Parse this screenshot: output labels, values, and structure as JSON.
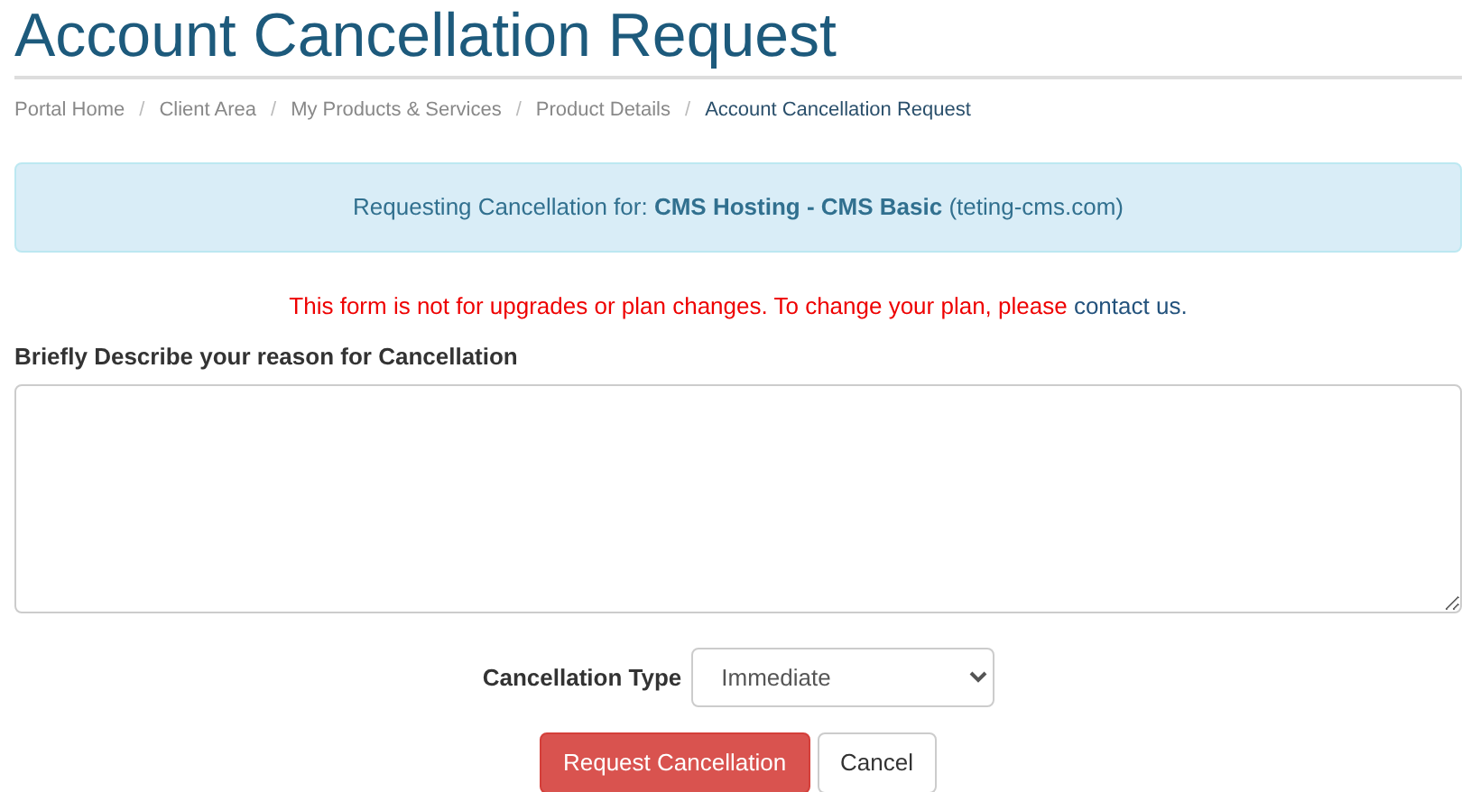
{
  "page_title": "Account Cancellation Request",
  "breadcrumb_separator": "/",
  "breadcrumb": [
    {
      "label": "Portal Home",
      "active": false
    },
    {
      "label": "Client Area",
      "active": false
    },
    {
      "label": "My Products & Services",
      "active": false
    },
    {
      "label": "Product Details",
      "active": false
    },
    {
      "label": "Account Cancellation Request",
      "active": true
    }
  ],
  "info_alert": "Requesting Cancellation for: **CMS Hosting - CMS Basic** (teting-cms.com)",
  "notice": {
    "text": "This form is not for upgrades or plan changes. To change your plan, please",
    "link": "contact us."
  },
  "reason_label": "Briefly Describe your reason for Cancellation",
  "cancellation_type": {
    "label": "Cancellation Type",
    "value": "Immediate"
  },
  "buttons": [
    {
      "label": "Request Cancellation",
      "kind": "danger"
    },
    {
      "label": "Cancel",
      "kind": "default"
    }
  ]
}
